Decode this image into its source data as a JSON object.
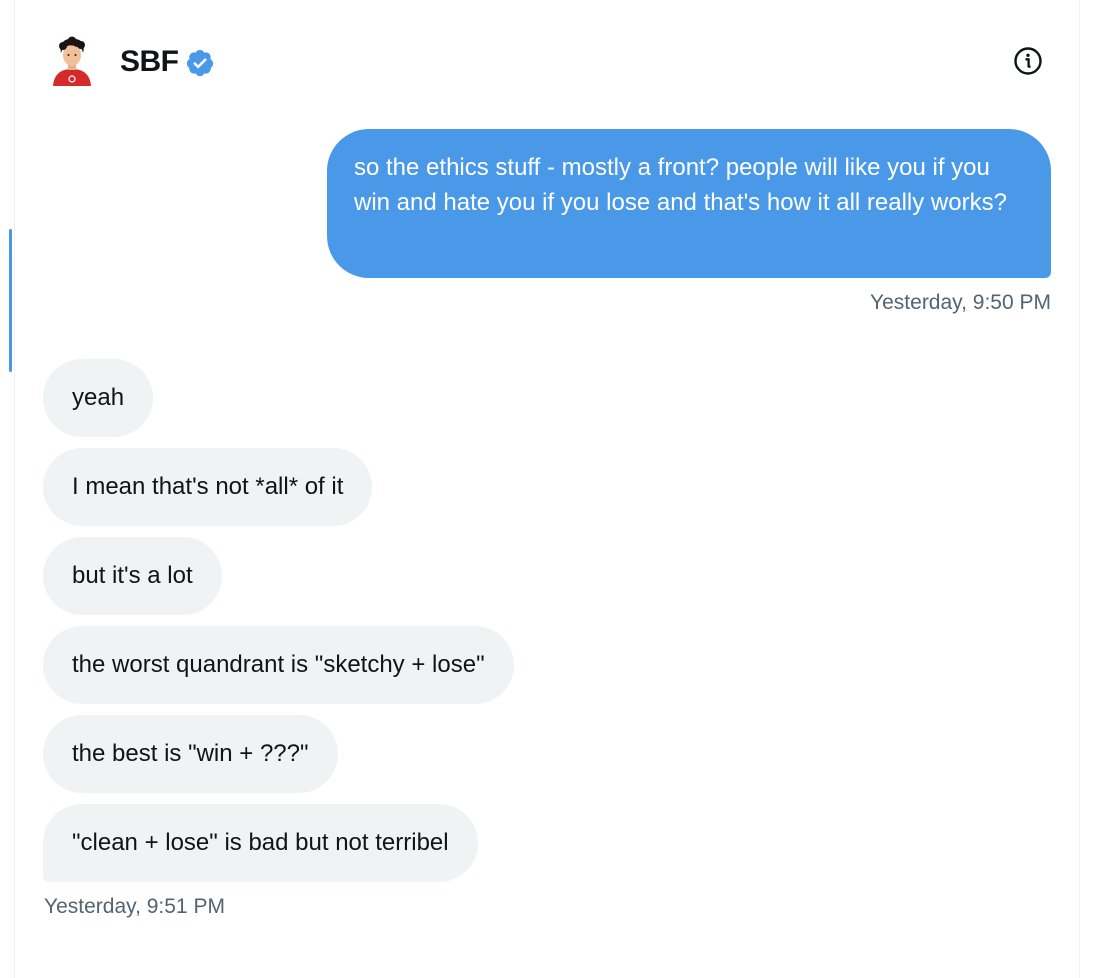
{
  "header": {
    "contact_name": "SBF",
    "avatar_icon": "avatar-person-red-shirt",
    "verified_icon": "verified-badge-icon",
    "info_icon": "info-circle-icon"
  },
  "conversation": {
    "sent": {
      "text": "so the ethics stuff - mostly a front? people will like you if you win and hate you if you lose and that's how it all really works?",
      "timestamp": "Yesterday, 9:50 PM"
    },
    "received": [
      {
        "text": "yeah"
      },
      {
        "text": "I mean that's not *all* of it"
      },
      {
        "text": "but it's a lot"
      },
      {
        "text": "the worst quandrant is \"sketchy + lose\""
      },
      {
        "text": "the best is \"win + ???\""
      },
      {
        "text": "\"clean + lose\" is bad but not terribel"
      }
    ],
    "received_timestamp": "Yesterday, 9:51 PM"
  },
  "colors": {
    "sent_bubble": "#4a99e9",
    "received_bubble": "#eff3f4",
    "verified": "#4a99e9",
    "timestamp": "#536471"
  }
}
